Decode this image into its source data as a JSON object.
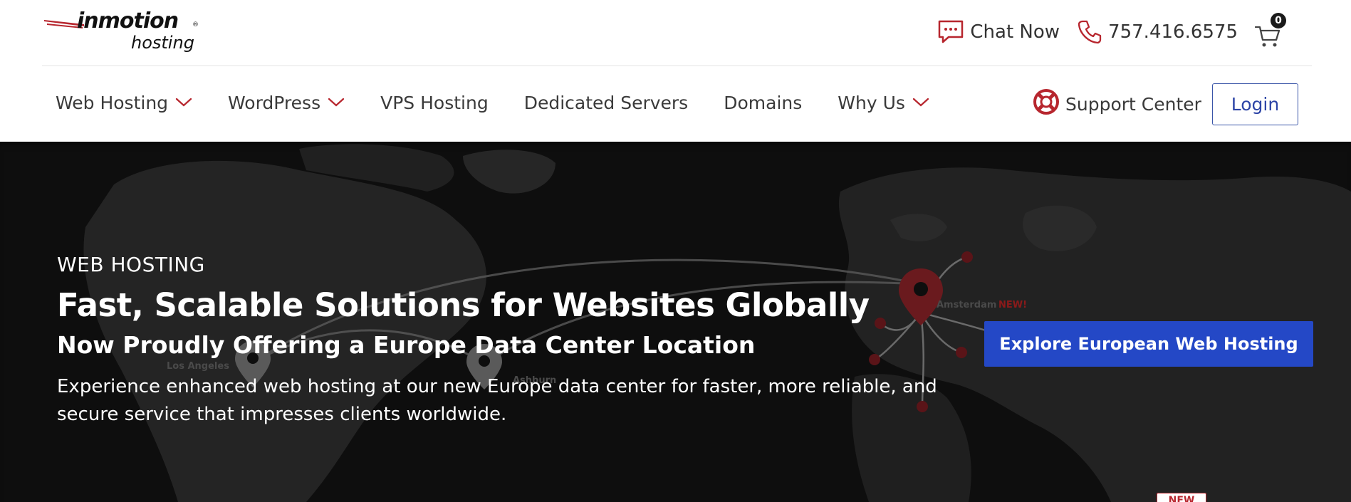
{
  "logo": {
    "main": "inmotion",
    "sub": "hosting",
    "reg": "®"
  },
  "top_utils": {
    "chat_label": "Chat Now",
    "phone": "757.416.6575",
    "cart_count": "0"
  },
  "nav": {
    "items": [
      {
        "label": "Web Hosting",
        "dropdown": true
      },
      {
        "label": "WordPress",
        "dropdown": true
      },
      {
        "label": "VPS Hosting",
        "dropdown": false
      },
      {
        "label": "Dedicated Servers",
        "dropdown": false
      },
      {
        "label": "Domains",
        "dropdown": false
      },
      {
        "label": "Why Us",
        "dropdown": true
      }
    ],
    "support_label": "Support Center",
    "login_label": "Login"
  },
  "hero": {
    "eyebrow": "WEB HOSTING",
    "headline": "Fast, Scalable Solutions for Websites Globally",
    "subhead": "Now Proudly Offering a Europe Data Center Location",
    "body": "Experience enhanced web hosting at our new Europe data center for faster, more reliable, and secure service that impresses clients worldwide.",
    "cta_label": "Explore European Web Hosting",
    "new_tag": "NEW",
    "map_labels": {
      "los_angeles": "Los Angeles",
      "ashburn": "Ashburn",
      "amsterdam": "Amsterdam",
      "amsterdam_new": "NEW!"
    }
  },
  "colors": {
    "accent_red": "#b7262e",
    "brand_blue": "#2448c6",
    "login_blue": "#2c44a6",
    "hero_bg": "#0e0e0e"
  },
  "icons": {
    "chat": "chat-bubble-icon",
    "phone": "phone-icon",
    "cart": "shopping-cart-icon",
    "chevron": "chevron-down-icon",
    "support": "lifebuoy-icon"
  }
}
